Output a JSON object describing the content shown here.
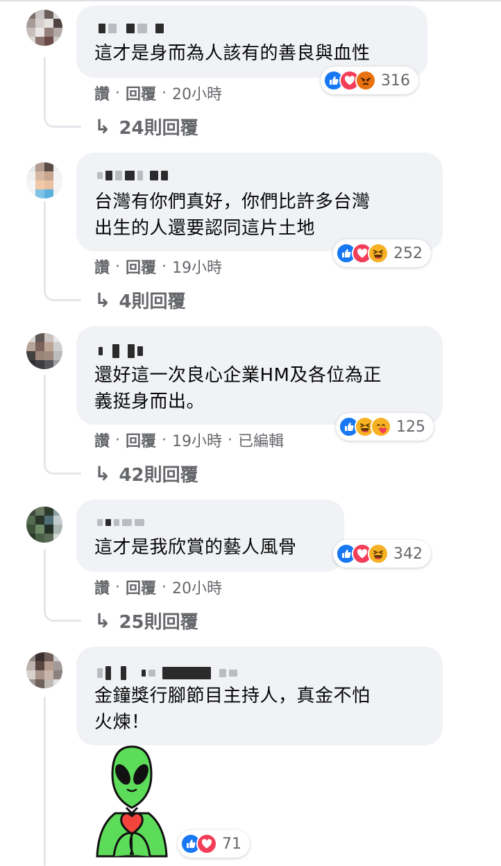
{
  "comments": [
    {
      "text": "這才是身而為人該有的善良與血性",
      "meta": {
        "like": "讚",
        "reply": "回覆",
        "time": "20小時",
        "edited": ""
      },
      "reactions": {
        "icons": [
          "like-icon",
          "love-icon",
          "angry-icon"
        ],
        "count": "316"
      },
      "replies": "24則回覆"
    },
    {
      "text": "台灣有你們真好，你們比許多台灣\n出生的人還要認同這片土地",
      "meta": {
        "like": "讚",
        "reply": "回覆",
        "time": "19小時",
        "edited": ""
      },
      "reactions": {
        "icons": [
          "like-icon",
          "love-icon",
          "haha-icon"
        ],
        "count": "252"
      },
      "replies": "4則回覆"
    },
    {
      "text": "還好這一次良心企業HM及各位為正\n義挺身而出。",
      "meta": {
        "like": "讚",
        "reply": "回覆",
        "time": "19小時",
        "edited": "已編輯"
      },
      "reactions": {
        "icons": [
          "like-icon",
          "haha-icon",
          "care-icon"
        ],
        "count": "125"
      },
      "replies": "42則回覆"
    },
    {
      "text": "這才是我欣賞的藝人風骨",
      "meta": {
        "like": "讚",
        "reply": "回覆",
        "time": "20小時",
        "edited": ""
      },
      "reactions": {
        "icons": [
          "like-icon",
          "love-icon",
          "haha-icon"
        ],
        "count": "342"
      },
      "replies": "25則回覆"
    },
    {
      "text": "金鐘獎行腳節目主持人，真金不怕\n火煉！",
      "meta": null,
      "reactions": {
        "icons": [
          "like-icon",
          "love-icon"
        ],
        "count": "71"
      },
      "replies": null,
      "sticker": "alien-holding-heart-sticker"
    }
  ],
  "colors": {
    "bubble": "#f0f2f5",
    "meta_text": "#65676b",
    "like": "#1877f2",
    "love": "#f33e58",
    "haha": "#f7b125",
    "angry": "#e9710f",
    "alien": "#5ddc5a"
  }
}
